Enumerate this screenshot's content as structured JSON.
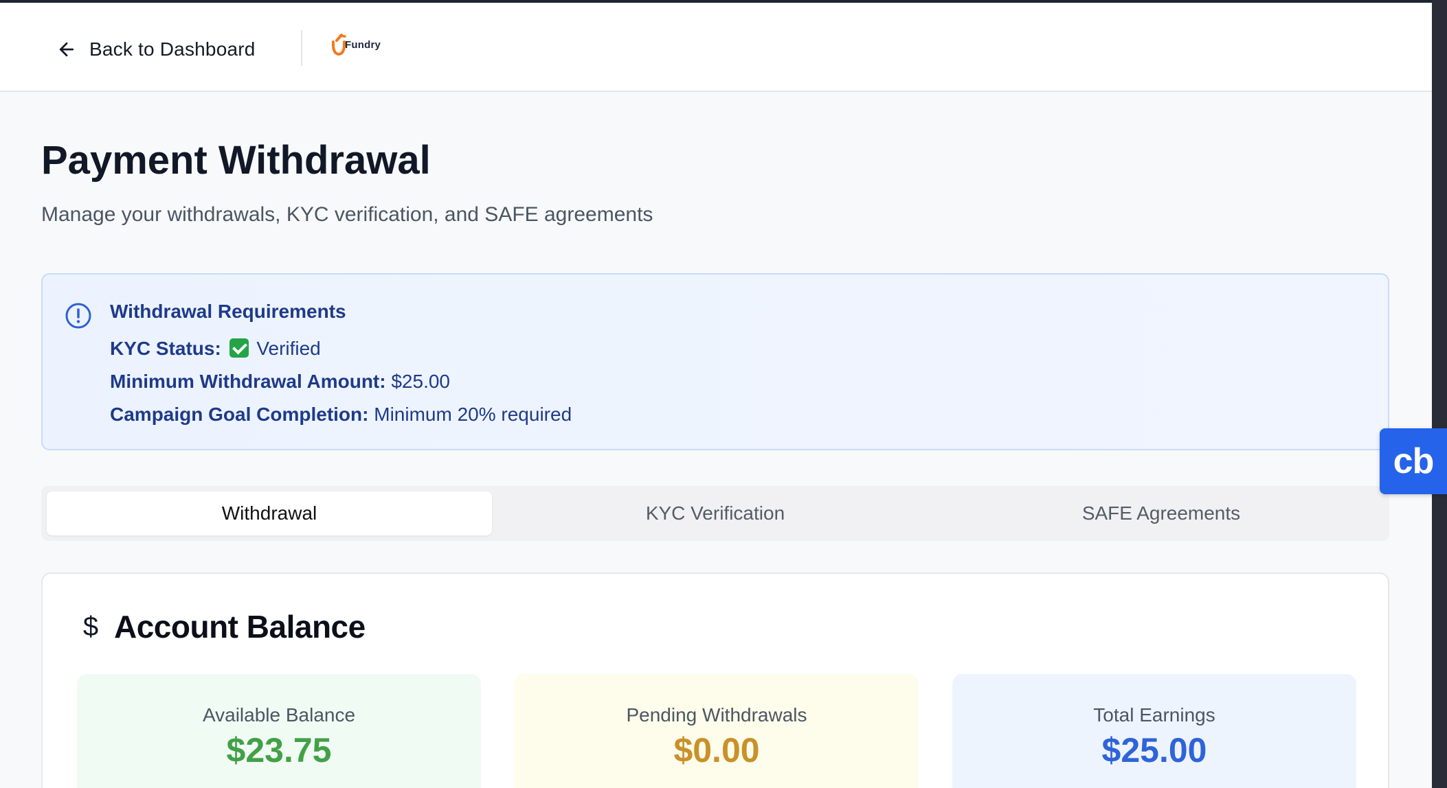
{
  "header": {
    "back_label": "Back to Dashboard",
    "logo_text": "Fundry"
  },
  "page": {
    "title": "Payment Withdrawal",
    "subtitle": "Manage your withdrawals, KYC verification, and SAFE agreements"
  },
  "requirements": {
    "title": "Withdrawal Requirements",
    "kyc_label": "KYC Status:",
    "kyc_value": "Verified",
    "min_label": "Minimum Withdrawal Amount:",
    "min_value": "$25.00",
    "goal_label": "Campaign Goal Completion:",
    "goal_value": "Minimum 20% required"
  },
  "tabs": [
    {
      "label": "Withdrawal",
      "active": true
    },
    {
      "label": "KYC Verification",
      "active": false
    },
    {
      "label": "SAFE Agreements",
      "active": false
    }
  ],
  "balance": {
    "title": "Account Balance",
    "stats": [
      {
        "label": "Available Balance",
        "value": "$23.75",
        "color": "#43a047",
        "bg": "#f0fbf3"
      },
      {
        "label": "Pending Withdrawals",
        "value": "$0.00",
        "color": "#c9912a",
        "bg": "#fefcea"
      },
      {
        "label": "Total Earnings",
        "value": "$25.00",
        "color": "#2f63d9",
        "bg": "#edf4fe"
      }
    ]
  },
  "widget": {
    "label": "cb"
  },
  "colors": {
    "accent": "#2563eb",
    "alert_text": "#1e3a8a",
    "logo_orange": "#f07b1e"
  }
}
